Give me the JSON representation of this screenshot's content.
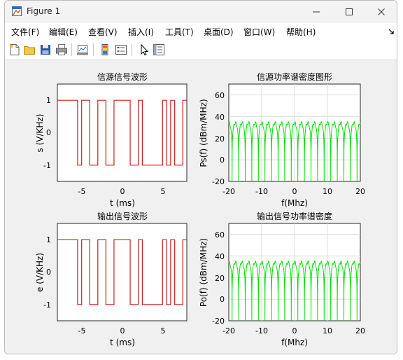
{
  "window": {
    "title": "Figure 1"
  },
  "menu": {
    "items": [
      "文件(F)",
      "编辑(E)",
      "查看(V)",
      "插入(I)",
      "工具(T)",
      "桌面(D)",
      "窗口(W)",
      "帮助(H)"
    ],
    "overflow_icon": "arrow-icon"
  },
  "toolbar": {
    "icons": [
      "new-figure-icon",
      "open-file-icon",
      "save-icon",
      "print-icon",
      "link-plot-icon",
      "insert-colorbar-icon",
      "insert-legend-icon",
      "edit-plot-icon",
      "property-inspector-icon"
    ]
  },
  "colors": {
    "signal": "#cc1f1f",
    "psd": "#00e000",
    "grid": "#dcdcdc"
  },
  "plots": {
    "p1": {
      "title": "信源信号波形",
      "xlabel": "t (ms)",
      "ylabel": "s (V/KHz)",
      "xticks": [
        "-5",
        "0",
        "5"
      ],
      "yticks": [
        "1",
        "0",
        "-1"
      ]
    },
    "p2": {
      "title": "信源功率谱密度图形",
      "xlabel": "f(Mhz)",
      "ylabel": "Ps(f) (dBm/MHz)",
      "xticks": [
        "-20",
        "-10",
        "0",
        "10",
        "20"
      ],
      "yticks": [
        "60",
        "40",
        "20",
        "0",
        "-20"
      ]
    },
    "p3": {
      "title": "输出信号波形",
      "xlabel": "t (ms)",
      "ylabel": "e (V/KHz)",
      "xticks": [
        "-5",
        "0",
        "5"
      ],
      "yticks": [
        "1",
        "0",
        "-1"
      ]
    },
    "p4": {
      "title": "输出信号功率谱密度",
      "xlabel": "f(Mhz)",
      "ylabel": "Po(f) (dBm/MHz)",
      "xticks": [
        "-20",
        "-10",
        "0",
        "10",
        "20"
      ],
      "yticks": [
        "60",
        "40",
        "20",
        "0",
        "-20"
      ]
    }
  },
  "chart_data": [
    {
      "type": "line",
      "title": "信源信号波形",
      "xlabel": "t (ms)",
      "ylabel": "s (V/KHz)",
      "xlim": [
        -8,
        8
      ],
      "ylim": [
        -1.5,
        1.5
      ],
      "grid": false,
      "x": [
        -8,
        -6,
        -5.5,
        -5,
        -4,
        -3,
        -2,
        -1,
        1,
        2,
        2.5,
        3,
        5,
        5.5,
        6,
        6.5,
        7,
        7.5,
        8
      ],
      "values": [
        1,
        1,
        -1,
        1,
        -1,
        1,
        -1,
        1,
        -1,
        1,
        -1,
        -1,
        1,
        -1,
        1,
        -1,
        -1,
        1,
        1
      ]
    },
    {
      "type": "line",
      "title": "信源功率谱密度图形",
      "xlabel": "f(Mhz)",
      "ylabel": "Ps(f) (dBm/MHz)",
      "xlim": [
        -20,
        20
      ],
      "ylim": [
        -20,
        70
      ],
      "grid": true,
      "series": [
        {
          "envelope_peak_dBm": 34,
          "null_spacing_MHz": 2.0,
          "floor_dBm": -20
        }
      ]
    },
    {
      "type": "line",
      "title": "输出信号波形",
      "xlabel": "t (ms)",
      "ylabel": "e (V/KHz)",
      "xlim": [
        -8,
        8
      ],
      "ylim": [
        -1.5,
        1.5
      ],
      "grid": false,
      "x": [
        -8,
        -6,
        -5.5,
        -5,
        -4,
        -3,
        -2,
        -1,
        1,
        2,
        2.5,
        3,
        5,
        5.5,
        6,
        6.5,
        7,
        7.5,
        8
      ],
      "values": [
        1,
        1,
        -1,
        1,
        -1,
        1,
        -1,
        1,
        -1,
        1,
        -1,
        -1,
        1,
        -1,
        1,
        -1,
        -1,
        1,
        1
      ]
    },
    {
      "type": "line",
      "title": "输出信号功率谱密度",
      "xlabel": "f(Mhz)",
      "ylabel": "Po(f) (dBm/MHz)",
      "xlim": [
        -20,
        20
      ],
      "ylim": [
        -20,
        70
      ],
      "grid": true,
      "series": [
        {
          "envelope_peak_dBm": 34,
          "null_spacing_MHz": 2.0,
          "floor_dBm": -20
        }
      ]
    }
  ]
}
